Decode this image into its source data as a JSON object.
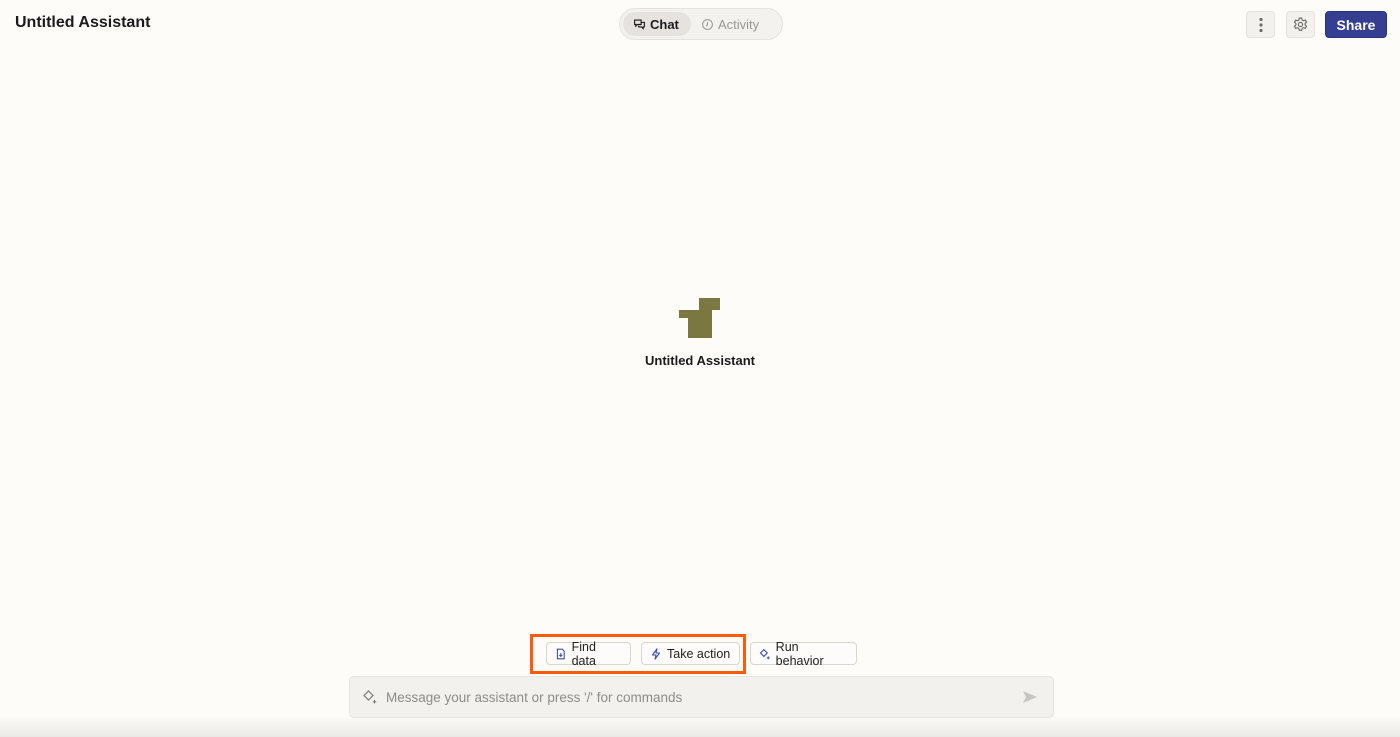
{
  "header": {
    "title": "Untitled Assistant",
    "tabs": [
      {
        "label": "Chat",
        "icon": "chat-bubbles-icon",
        "active": true
      },
      {
        "label": "Activity",
        "icon": "clock-icon",
        "active": false
      }
    ],
    "more_icon": "vertical-dots-icon",
    "settings_icon": "gear-icon",
    "share_label": "Share"
  },
  "main": {
    "assistant_name": "Untitled Assistant",
    "logo_color": "#7a7740"
  },
  "quick_actions": [
    {
      "label": "Find data",
      "icon": "file-search-icon"
    },
    {
      "label": "Take action",
      "icon": "lightning-icon"
    },
    {
      "label": "Run behavior",
      "icon": "sparkle-diamond-icon"
    }
  ],
  "composer": {
    "placeholder": "Message your assistant or press '/' for commands",
    "value": ""
  },
  "colors": {
    "accent": "#343f91",
    "highlight": "#ff5a0a",
    "background": "#fdfcf9"
  }
}
